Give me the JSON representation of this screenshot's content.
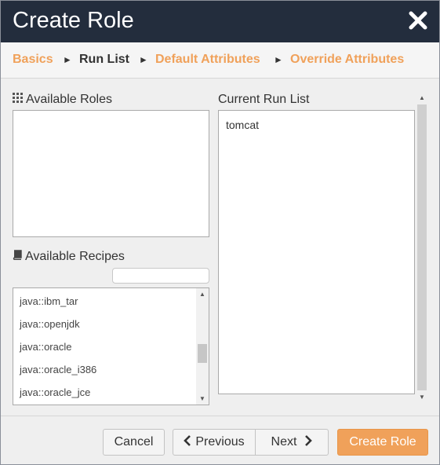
{
  "dialog": {
    "title": "Create Role",
    "close_icon": "close-icon"
  },
  "breadcrumb": {
    "steps": [
      {
        "label": "Basics",
        "state": "link"
      },
      {
        "label": "Run List",
        "state": "active"
      },
      {
        "label": "Default Attributes",
        "state": "link"
      },
      {
        "label": "Override Attributes",
        "state": "link"
      }
    ],
    "separator": "►"
  },
  "available_roles": {
    "label": "Available Roles",
    "icon": "grid-icon",
    "items": []
  },
  "available_recipes": {
    "label": "Available Recipes",
    "icon": "book-icon",
    "filter": {
      "value": "",
      "placeholder": ""
    },
    "items": [
      "java::ibm_tar",
      "java::openjdk",
      "java::oracle",
      "java::oracle_i386",
      "java::oracle_jce"
    ]
  },
  "current_run_list": {
    "label": "Current Run List",
    "items": [
      "tomcat"
    ]
  },
  "footer": {
    "cancel_label": "Cancel",
    "previous_label": "Previous",
    "next_label": "Next",
    "create_label": "Create Role"
  },
  "colors": {
    "titlebar": "#232d3d",
    "accent": "#f0a15a",
    "body": "#efefef"
  }
}
